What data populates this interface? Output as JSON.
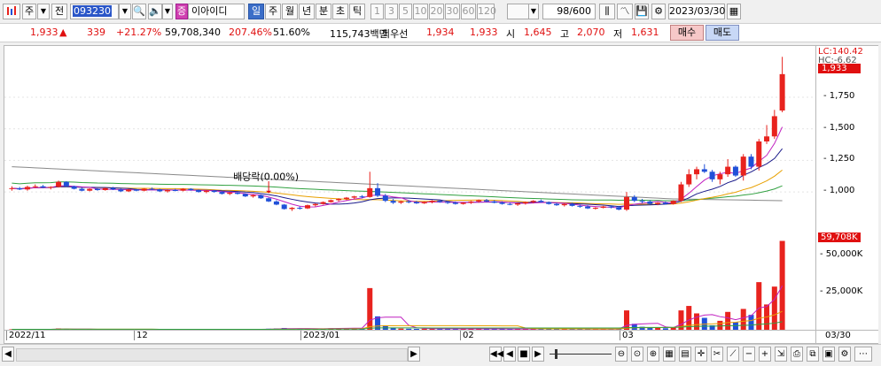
{
  "toolbar": {
    "market_icon": "chart-menu-icon",
    "market_label": "주",
    "prev_label": "전",
    "code_value": "093230",
    "stock_badge": "증",
    "stock_name": "이아이디",
    "period_tabs": [
      "일",
      "주",
      "월",
      "년",
      "분",
      "초",
      "틱"
    ],
    "active_period": "일",
    "minute_options": [
      "1",
      "3",
      "5",
      "10",
      "20",
      "30",
      "60",
      "120"
    ],
    "view_count": "98/600",
    "date_value": "2023/03/30"
  },
  "info": {
    "price": "1,933",
    "arrow": "▲",
    "change": "339",
    "change_pct": "+21.27%",
    "volume": "59,708,340",
    "volume_ratio": "207.46%",
    "turnover_pct": "51.60%",
    "trade_value": "115,743백만",
    "best_bid_label": "최우선",
    "best_ask": "1,934",
    "best_bid": "1,933",
    "open_label": "시",
    "open": "1,645",
    "high_label": "고",
    "high": "2,070",
    "low_label": "저",
    "low": "1,631",
    "buy_label": "매수",
    "sell_label": "매도"
  },
  "price_axis": {
    "lc_label": "LC:140.42",
    "hc_label": "HC:-6.62",
    "current_tag": "1,933",
    "ticks": [
      "1,750",
      "1,500",
      "1,250",
      "1,000"
    ]
  },
  "volume_axis": {
    "current_tag": "59,708K",
    "ticks": [
      "50,000K",
      "25,000K"
    ]
  },
  "date_axis": {
    "labels": [
      "2022/11",
      "12",
      "2023/01",
      "02",
      "03"
    ],
    "corner": "03/30"
  },
  "annotation": {
    "dividend": "배당락(0.00%)"
  },
  "colors": {
    "up": "#e8231e",
    "down": "#2050d8",
    "ma5": "#c020c0",
    "ma20": "#1a1a8a",
    "ma60": "#e8a000",
    "ma120": "#30a040",
    "ma240": "#888888"
  },
  "chart_data": {
    "type": "candlestick",
    "ylim": [
      700,
      2100
    ],
    "volume_ylim": [
      0,
      60000
    ],
    "candles": [
      [
        1025,
        1045,
        1010,
        1030
      ],
      [
        1030,
        1040,
        1015,
        1020
      ],
      [
        1020,
        1050,
        1010,
        1040
      ],
      [
        1040,
        1060,
        1030,
        1045
      ],
      [
        1045,
        1055,
        1030,
        1035
      ],
      [
        1035,
        1045,
        1020,
        1040
      ],
      [
        1040,
        1090,
        1035,
        1080
      ],
      [
        1080,
        1085,
        1040,
        1045
      ],
      [
        1045,
        1050,
        1020,
        1025
      ],
      [
        1025,
        1035,
        1005,
        1010
      ],
      [
        1010,
        1030,
        1005,
        1025
      ],
      [
        1025,
        1030,
        1010,
        1015
      ],
      [
        1015,
        1035,
        1010,
        1030
      ],
      [
        1030,
        1040,
        1015,
        1020
      ],
      [
        1020,
        1025,
        1000,
        1005
      ],
      [
        1005,
        1025,
        1000,
        1020
      ],
      [
        1020,
        1025,
        1005,
        1010
      ],
      [
        1010,
        1030,
        1005,
        1025
      ],
      [
        1025,
        1035,
        1015,
        1020
      ],
      [
        1020,
        1025,
        1000,
        1005
      ],
      [
        1005,
        1020,
        995,
        1015
      ],
      [
        1015,
        1025,
        1005,
        1010
      ],
      [
        1010,
        1030,
        1005,
        1025
      ],
      [
        1025,
        1030,
        1010,
        1015
      ],
      [
        1015,
        1020,
        995,
        1000
      ],
      [
        1000,
        1015,
        990,
        1010
      ],
      [
        1010,
        1015,
        995,
        1000
      ],
      [
        1000,
        1005,
        980,
        985
      ],
      [
        985,
        1000,
        975,
        995
      ],
      [
        995,
        1000,
        980,
        985
      ],
      [
        985,
        990,
        960,
        965
      ],
      [
        965,
        980,
        955,
        975
      ],
      [
        975,
        980,
        945,
        950
      ],
      [
        950,
        955,
        920,
        925
      ],
      [
        925,
        935,
        895,
        900
      ],
      [
        900,
        905,
        860,
        865
      ],
      [
        865,
        880,
        850,
        875
      ],
      [
        875,
        885,
        860,
        870
      ],
      [
        870,
        900,
        865,
        895
      ],
      [
        895,
        910,
        885,
        905
      ],
      [
        905,
        925,
        900,
        920
      ],
      [
        920,
        940,
        915,
        935
      ],
      [
        935,
        950,
        925,
        945
      ],
      [
        945,
        960,
        935,
        955
      ],
      [
        955,
        970,
        945,
        965
      ],
      [
        965,
        975,
        950,
        960
      ],
      [
        960,
        1160,
        955,
        1030
      ],
      [
        1030,
        1070,
        960,
        970
      ],
      [
        970,
        985,
        920,
        930
      ],
      [
        930,
        945,
        905,
        915
      ],
      [
        915,
        930,
        905,
        925
      ],
      [
        925,
        935,
        910,
        920
      ],
      [
        920,
        930,
        905,
        910
      ],
      [
        910,
        925,
        905,
        920
      ],
      [
        920,
        935,
        910,
        930
      ],
      [
        930,
        940,
        915,
        920
      ],
      [
        920,
        930,
        905,
        915
      ],
      [
        915,
        925,
        900,
        905
      ],
      [
        905,
        920,
        900,
        915
      ],
      [
        915,
        930,
        905,
        925
      ],
      [
        925,
        940,
        915,
        935
      ],
      [
        935,
        945,
        920,
        925
      ],
      [
        925,
        935,
        910,
        915
      ],
      [
        915,
        925,
        900,
        905
      ],
      [
        905,
        915,
        895,
        900
      ],
      [
        900,
        915,
        890,
        910
      ],
      [
        910,
        925,
        900,
        920
      ],
      [
        920,
        935,
        910,
        930
      ],
      [
        930,
        940,
        915,
        920
      ],
      [
        920,
        925,
        900,
        905
      ],
      [
        905,
        915,
        890,
        895
      ],
      [
        895,
        910,
        885,
        905
      ],
      [
        905,
        915,
        885,
        890
      ],
      [
        890,
        900,
        875,
        885
      ],
      [
        885,
        895,
        865,
        870
      ],
      [
        870,
        880,
        860,
        875
      ],
      [
        875,
        890,
        870,
        885
      ],
      [
        885,
        895,
        870,
        880
      ],
      [
        880,
        890,
        855,
        860
      ],
      [
        860,
        1000,
        850,
        960
      ],
      [
        960,
        975,
        920,
        930
      ],
      [
        930,
        945,
        910,
        925
      ],
      [
        925,
        935,
        900,
        905
      ],
      [
        905,
        920,
        895,
        915
      ],
      [
        915,
        925,
        900,
        905
      ],
      [
        905,
        935,
        900,
        930
      ],
      [
        930,
        1080,
        920,
        1060
      ],
      [
        1060,
        1180,
        1040,
        1140
      ],
      [
        1140,
        1200,
        1100,
        1180
      ],
      [
        1180,
        1220,
        1150,
        1160
      ],
      [
        1160,
        1175,
        1080,
        1100
      ],
      [
        1100,
        1160,
        1060,
        1140
      ],
      [
        1140,
        1260,
        1120,
        1200
      ],
      [
        1200,
        1210,
        1120,
        1130
      ],
      [
        1130,
        1300,
        1090,
        1280
      ],
      [
        1280,
        1300,
        1180,
        1200
      ],
      [
        1200,
        1420,
        1170,
        1400
      ],
      [
        1400,
        1530,
        1380,
        1440
      ],
      [
        1440,
        1650,
        1420,
        1600
      ],
      [
        1645,
        2070,
        1631,
        1933
      ]
    ],
    "volumes": [
      300,
      250,
      400,
      350,
      280,
      300,
      900,
      500,
      300,
      250,
      280,
      260,
      320,
      300,
      250,
      270,
      260,
      300,
      280,
      250,
      260,
      270,
      300,
      280,
      250,
      260,
      240,
      300,
      280,
      260,
      320,
      300,
      450,
      700,
      900,
      1200,
      600,
      500,
      700,
      800,
      900,
      1000,
      950,
      1100,
      1200,
      1000,
      28000,
      9000,
      3000,
      1500,
      800,
      700,
      600,
      700,
      800,
      600,
      550,
      500,
      600,
      700,
      650,
      600,
      550,
      500,
      450,
      500,
      600,
      700,
      600,
      500,
      450,
      500,
      550,
      500,
      450,
      400,
      500,
      450,
      400,
      13000,
      4000,
      2000,
      1500,
      1200,
      1000,
      1500,
      13000,
      16000,
      11000,
      8000,
      3000,
      6000,
      12000,
      5000,
      14000,
      10000,
      32000,
      17000,
      29000,
      59708
    ]
  }
}
